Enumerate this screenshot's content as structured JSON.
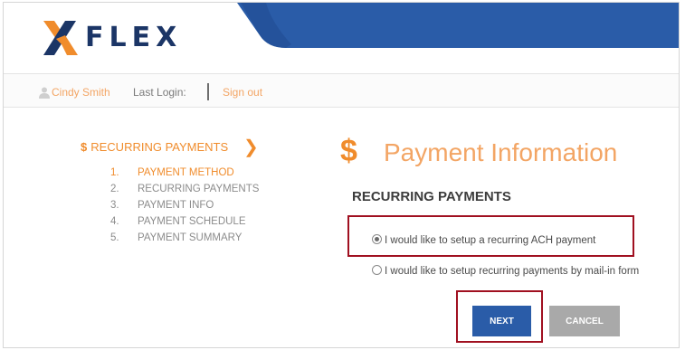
{
  "header": {
    "logo_text": "FLEX",
    "colors": {
      "brand_navy": "#1b3566",
      "brand_orange": "#f08c2c",
      "header_blue": "#2a5ca8"
    }
  },
  "userbar": {
    "user_icon": "user-icon",
    "user_name": "Cindy Smith",
    "last_login_label": "Last Login:",
    "sign_out_label": "Sign out"
  },
  "sidebar": {
    "heading_icon": "$",
    "heading": "RECURRING PAYMENTS",
    "chevron": "❯",
    "steps": [
      {
        "num": "1.",
        "label": "PAYMENT METHOD",
        "active": true
      },
      {
        "num": "2.",
        "label": "RECURRING PAYMENTS",
        "active": false
      },
      {
        "num": "3.",
        "label": "PAYMENT INFO",
        "active": false
      },
      {
        "num": "4.",
        "label": "PAYMENT SCHEDULE",
        "active": false
      },
      {
        "num": "5.",
        "label": "PAYMENT SUMMARY",
        "active": false
      }
    ]
  },
  "main": {
    "title_icon": "$",
    "title": "Payment Information",
    "section_title": "RECURRING PAYMENTS",
    "options": [
      {
        "label": "I would like to setup a recurring ACH payment",
        "selected": true
      },
      {
        "label": "I would like to setup recurring payments by mail-in form",
        "selected": false
      }
    ],
    "next_label": "NEXT",
    "cancel_label": "CANCEL"
  }
}
